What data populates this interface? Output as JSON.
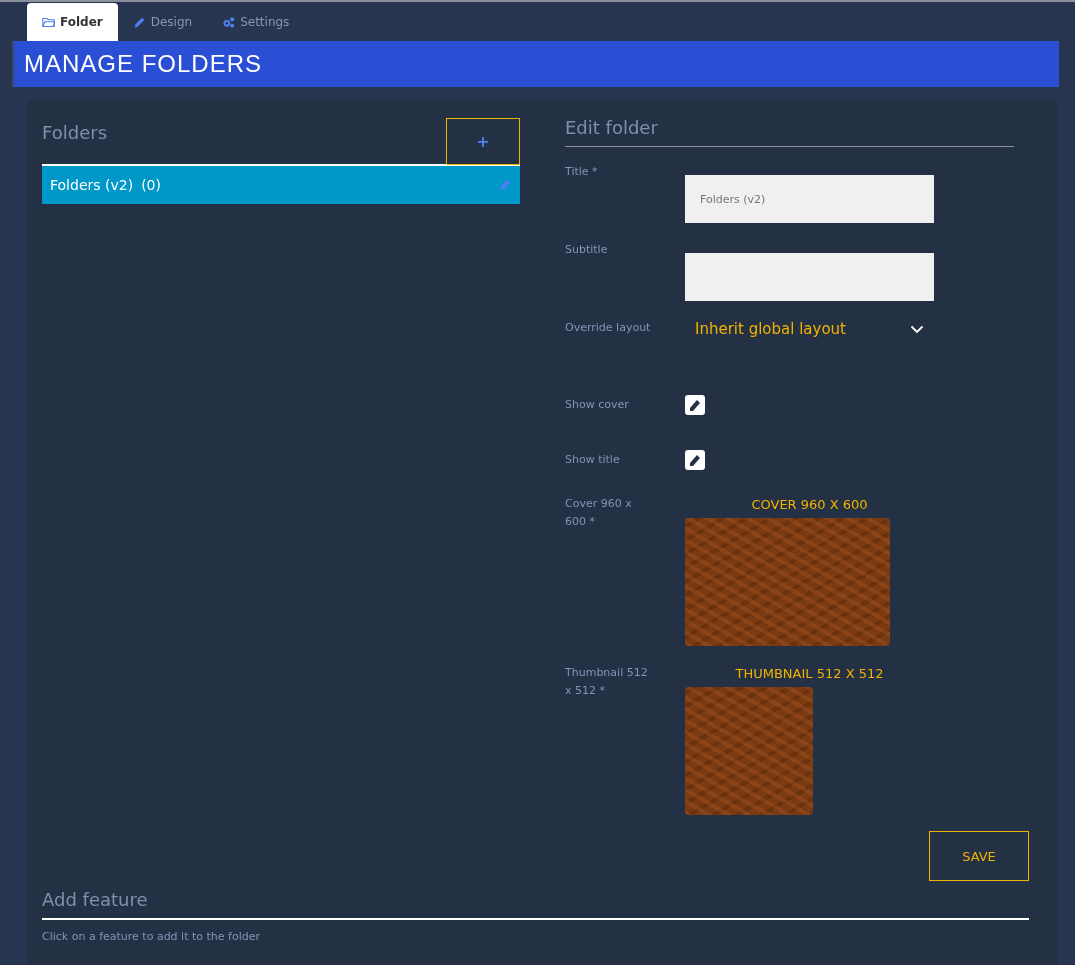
{
  "tabs": [
    {
      "label": "Folder",
      "selected": true
    },
    {
      "label": "Design",
      "selected": false
    },
    {
      "label": "Settings",
      "selected": false
    }
  ],
  "header": {
    "title": "MANAGE FOLDERS"
  },
  "folders": {
    "title": "Folders",
    "add_button": "+",
    "items": [
      {
        "label": "Folders (v2)",
        "count": "(0)",
        "selected": true
      }
    ]
  },
  "edit_folder": {
    "title": "Edit folder",
    "fields": [
      {
        "kind": "text",
        "label": "Title *",
        "value": "Folders (v2)"
      },
      {
        "kind": "text",
        "label": "Subtitle"
      },
      {
        "kind": "select",
        "label": "Override layout",
        "value": "Inherit global layout"
      },
      {
        "kind": "checkbox",
        "label": "Show cover",
        "checked": true
      },
      {
        "kind": "checkbox",
        "label": "Show title",
        "checked": true
      },
      {
        "kind": "image",
        "label": "Cover 960 x 600 *",
        "caption": "COVER 960 X 600"
      },
      {
        "kind": "image",
        "label": "Thumbnail 512 x 512 *",
        "caption": "THUMBNAIL 512 X 512"
      }
    ],
    "save_button": "SAVE"
  },
  "add_feature": {
    "title": "Add feature",
    "hint": "Click on a feature to add it to the folder"
  }
}
